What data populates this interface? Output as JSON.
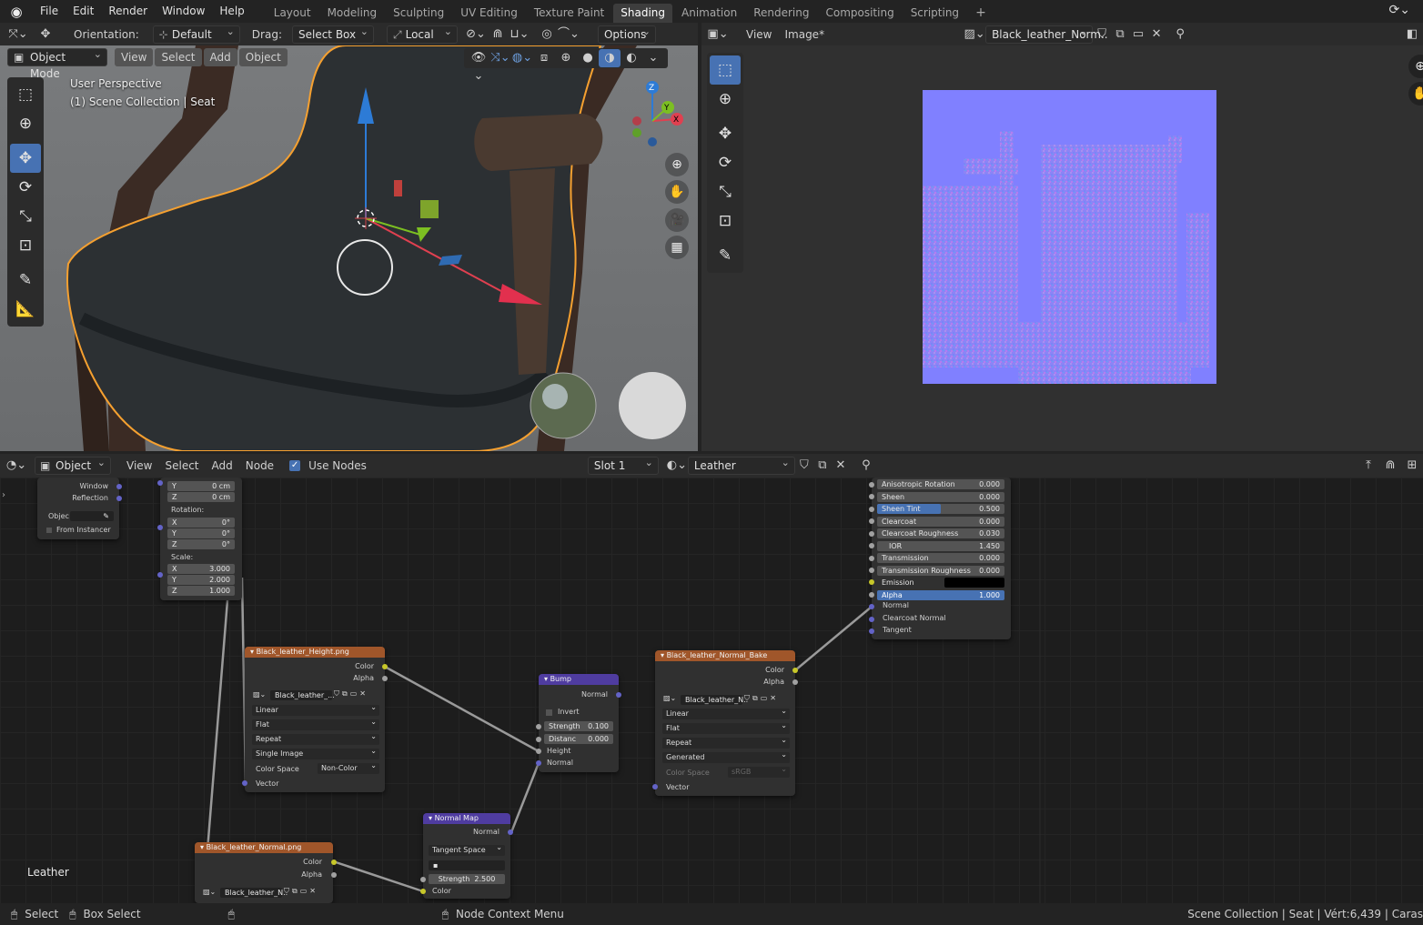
{
  "topbar": {
    "menus": [
      "File",
      "Edit",
      "Render",
      "Window",
      "Help"
    ],
    "workspaces": [
      "Layout",
      "Modeling",
      "Sculpting",
      "UV Editing",
      "Texture Paint",
      "Shading",
      "Animation",
      "Rendering",
      "Compositing",
      "Scripting"
    ],
    "add_tab": "+"
  },
  "toolheader": {
    "orientation_label": "Orientation:",
    "orientation_value": "Default",
    "drag_label": "Drag:",
    "drag_value": "Select Box",
    "pivot_value": "Local",
    "options_label": "Options"
  },
  "viewport": {
    "mode": "Object Mode",
    "menus": [
      "View",
      "Select",
      "Add",
      "Object"
    ],
    "overlay_line1": "User Perspective",
    "overlay_line2": "(1) Scene Collection | Seat",
    "gizmo": {
      "z": "Z",
      "y": "Y",
      "x": "X"
    }
  },
  "image_editor": {
    "menus": [
      "View",
      "Image*"
    ],
    "image_name": "Black_leather_Norm.."
  },
  "node_editor": {
    "header": {
      "object_type": "Object",
      "menus": [
        "View",
        "Select",
        "Add",
        "Node"
      ],
      "use_nodes_label": "Use Nodes",
      "slot": "Slot 1",
      "material": "Leather"
    },
    "material_label": "Leather",
    "texcoord": {
      "window": "Window",
      "reflection": "Reflection",
      "object_label": "Objec",
      "from_instancer": "From Instancer"
    },
    "mapping": {
      "loc_y": {
        "axis": "Y",
        "value": "0 cm"
      },
      "loc_z": {
        "axis": "Z",
        "value": "0 cm"
      },
      "rotation_label": "Rotation:",
      "rot": [
        {
          "axis": "X",
          "value": "0°"
        },
        {
          "axis": "Y",
          "value": "0°"
        },
        {
          "axis": "Z",
          "value": "0°"
        }
      ],
      "scale_label": "Scale:",
      "scale": [
        {
          "axis": "X",
          "value": "3.000"
        },
        {
          "axis": "Y",
          "value": "2.000"
        },
        {
          "axis": "Z",
          "value": "1.000"
        }
      ]
    },
    "height_tex": {
      "title": "Black_leather_Height.png",
      "out_color": "Color",
      "out_alpha": "Alpha",
      "image": "Black_leather_...",
      "interp": "Linear",
      "proj": "Flat",
      "ext": "Repeat",
      "source": "Single Image",
      "cs_label": "Color Space",
      "cs_value": "Non-Color",
      "in_vector": "Vector"
    },
    "bump": {
      "title": "Bump",
      "out_normal": "Normal",
      "invert": "Invert",
      "strength_label": "Strength",
      "strength_value": "0.100",
      "distance_label": "Distanc",
      "distance_value": "0.000",
      "in_height": "Height",
      "in_normal": "Normal"
    },
    "normal_bake": {
      "title": "Black_leather_Normal_Bake",
      "out_color": "Color",
      "out_alpha": "Alpha",
      "image": "Black_leather_N..",
      "interp": "Linear",
      "proj": "Flat",
      "ext": "Repeat",
      "source": "Generated",
      "cs_label": "Color Space",
      "cs_value": "sRGB",
      "in_vector": "Vector"
    },
    "normal_map": {
      "title": "Normal Map",
      "out_normal": "Normal",
      "space": "Tangent Space",
      "strength_label": "Strength",
      "strength_value": "2.500",
      "in_color": "Color"
    },
    "normal_tex": {
      "title": "Black_leather_Normal.png",
      "out_color": "Color",
      "out_alpha": "Alpha",
      "image": "Black_leather_N.."
    },
    "bsdf": {
      "rows": [
        {
          "label": "Anisotropic Rotation",
          "value": "0.000"
        },
        {
          "label": "Sheen",
          "value": "0.000"
        },
        {
          "label": "Sheen Tint",
          "value": "0.500"
        },
        {
          "label": "Clearcoat",
          "value": "0.000"
        },
        {
          "label": "Clearcoat Roughness",
          "value": "0.030"
        },
        {
          "label": "IOR",
          "value": "1.450"
        },
        {
          "label": "Transmission",
          "value": "0.000"
        },
        {
          "label": "Transmission Roughness",
          "value": "0.000"
        },
        {
          "label": "Emission",
          "value": ""
        },
        {
          "label": "Alpha",
          "value": "1.000"
        }
      ],
      "sheen_tint_fraction": 0.5,
      "alpha_fraction": 1.0,
      "emission_color": "#000000",
      "inputs": [
        "Normal",
        "Clearcoat Normal",
        "Tangent"
      ]
    }
  },
  "statusbar": {
    "select": "Select",
    "box_select": "Box Select",
    "context_menu": "Node Context Menu",
    "stats": "Scene Collection | Seat | Vért:6,439 | Caras"
  },
  "colors": {
    "accent": "#4772b3",
    "texture_node_header": "#a0562a",
    "vector_node_header": "#4f3ca0",
    "selection_outline": "#f5a030",
    "normal_map_base": "#8080ff"
  }
}
